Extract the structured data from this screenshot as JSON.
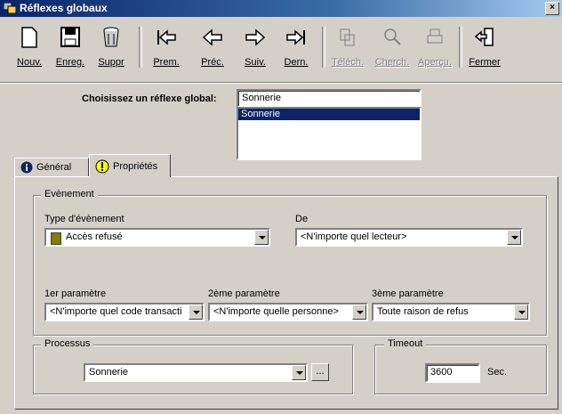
{
  "window": {
    "title": "Réflexes globaux",
    "close": "×"
  },
  "toolbar": {
    "buttons": [
      {
        "label": "Nouv.",
        "icon": "new-document-icon",
        "enabled": true
      },
      {
        "label": "Enreg.",
        "icon": "floppy-disk-icon",
        "enabled": true
      },
      {
        "label": "Suppr",
        "icon": "trash-can-icon",
        "enabled": true
      },
      {
        "label": "Prem.",
        "icon": "first-arrow-icon",
        "enabled": true
      },
      {
        "label": "Préc.",
        "icon": "previous-arrow-icon",
        "enabled": true
      },
      {
        "label": "Suiv.",
        "icon": "next-arrow-icon",
        "enabled": true
      },
      {
        "label": "Dern.",
        "icon": "last-arrow-icon",
        "enabled": true
      },
      {
        "label": "Téléch.",
        "icon": "download-icon",
        "enabled": false
      },
      {
        "label": "Cherch.",
        "icon": "search-icon",
        "enabled": false
      },
      {
        "label": "Aperçu.",
        "icon": "print-preview-icon",
        "enabled": false
      },
      {
        "label": "Fermer",
        "icon": "exit-door-icon",
        "enabled": true
      }
    ]
  },
  "selector": {
    "label": "Choisissez un réflexe global:",
    "value": "Sonnerie",
    "list_items": [
      "Sonnerie"
    ]
  },
  "tabs": [
    {
      "label": "Général",
      "icon": "info-icon",
      "active": false
    },
    {
      "label": "Propriétés",
      "icon": "exclamation-icon",
      "active": true
    }
  ],
  "event_group": {
    "title": "Evènement",
    "event_type": {
      "label": "Type d'évènement",
      "value": "Accès refusé"
    },
    "from": {
      "label": "De",
      "value": "<N'importe quel lecteur>"
    },
    "param1": {
      "label": "1er paramètre",
      "value": "<N'importe quel code transacti"
    },
    "param2": {
      "label": "2ème paramètre",
      "value": "<N'importe quelle personne>"
    },
    "param3": {
      "label": "3ème paramètre",
      "value": "Toute raison de refus"
    }
  },
  "process_group": {
    "title": "Processus",
    "value": "Sonnerie",
    "browse_label": "..."
  },
  "timeout_group": {
    "title": "Timeout",
    "value": "3600",
    "unit": "Sec."
  },
  "colors": {
    "selection": "#0a246a",
    "face": "#d4d0c8",
    "info_icon": "#0a246a",
    "warning_icon": "#ffff00"
  }
}
